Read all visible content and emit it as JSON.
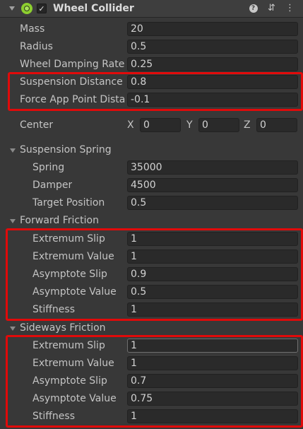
{
  "header": {
    "title": "Wheel Collider",
    "enabled_check": "✓",
    "icons": [
      "help-icon",
      "preset-icon",
      "more-menu-icon"
    ],
    "help_glyph": "?",
    "preset_glyph": "⇵",
    "more_glyph": "⋮"
  },
  "properties": {
    "mass": {
      "label": "Mass",
      "value": "20"
    },
    "radius": {
      "label": "Radius",
      "value": "0.5"
    },
    "damping": {
      "label": "Wheel Damping Rate",
      "value": "0.25"
    },
    "suspension_distance": {
      "label": "Suspension Distance",
      "value": "0.8"
    },
    "force_app": {
      "label": "Force App Point Distance",
      "value": "-0.1"
    }
  },
  "center": {
    "label": "Center",
    "x_label": "X",
    "x": "0",
    "y_label": "Y",
    "y": "0",
    "z_label": "Z",
    "z": "0"
  },
  "suspension_spring": {
    "title": "Suspension Spring",
    "spring": {
      "label": "Spring",
      "value": "35000"
    },
    "damper": {
      "label": "Damper",
      "value": "4500"
    },
    "target": {
      "label": "Target Position",
      "value": "0.5"
    }
  },
  "forward_friction": {
    "title": "Forward Friction",
    "ext_slip": {
      "label": "Extremum Slip",
      "value": "1"
    },
    "ext_value": {
      "label": "Extremum Value",
      "value": "1"
    },
    "asy_slip": {
      "label": "Asymptote Slip",
      "value": "0.9"
    },
    "asy_value": {
      "label": "Asymptote Value",
      "value": "0.5"
    },
    "stiffness": {
      "label": "Stiffness",
      "value": "1"
    }
  },
  "sideways_friction": {
    "title": "Sideways Friction",
    "ext_slip": {
      "label": "Extremum Slip",
      "value": "1"
    },
    "ext_value": {
      "label": "Extremum Value",
      "value": "1"
    },
    "asy_slip": {
      "label": "Asymptote Slip",
      "value": "0.7"
    },
    "asy_value": {
      "label": "Asymptote Value",
      "value": "0.75"
    },
    "stiffness": {
      "label": "Stiffness",
      "value": "1"
    }
  },
  "colors": {
    "background": "#383838",
    "field": "#2a2a2a",
    "highlight": "#e10a0a",
    "component_icon": "#8dcf2f"
  }
}
